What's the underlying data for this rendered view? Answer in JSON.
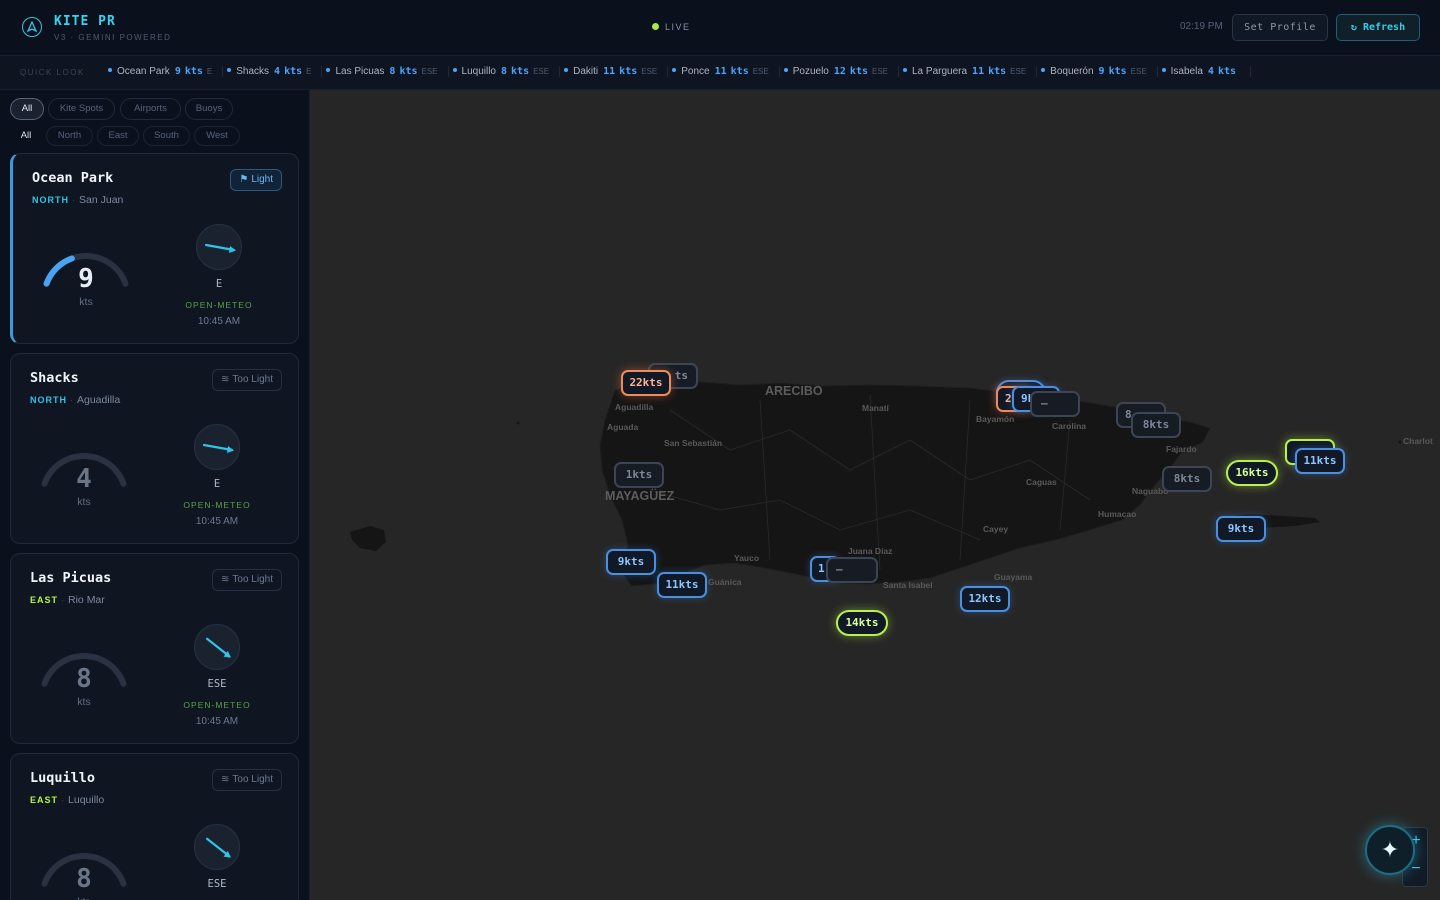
{
  "header": {
    "title": "KITE PR",
    "subtitle": "V3 · GEMINI POWERED",
    "live_label": "LIVE",
    "time": "02:19 PM",
    "set_profile": "Set Profile",
    "refresh": "↻ Refresh",
    "colors": {
      "accent": "#34d3f0",
      "live": "#a8e84a"
    }
  },
  "ticker": {
    "label": "QUICK LOOK",
    "items": [
      {
        "name": "Ocean Park",
        "value": "9",
        "unit": "kts",
        "dir": "E"
      },
      {
        "name": "Shacks",
        "value": "4",
        "unit": "kts",
        "dir": "E"
      },
      {
        "name": "Las Picuas",
        "value": "8",
        "unit": "kts",
        "dir": "ESE"
      },
      {
        "name": "Luquillo",
        "value": "8",
        "unit": "kts",
        "dir": "ESE"
      },
      {
        "name": "Dakiti",
        "value": "11",
        "unit": "kts",
        "dir": "ESE"
      },
      {
        "name": "Ponce",
        "value": "11",
        "unit": "kts",
        "dir": "ESE"
      },
      {
        "name": "Pozuelo",
        "value": "12",
        "unit": "kts",
        "dir": "ESE"
      },
      {
        "name": "La Parguera",
        "value": "11",
        "unit": "kts",
        "dir": "ESE"
      },
      {
        "name": "Boquerón",
        "value": "9",
        "unit": "kts",
        "dir": "ESE"
      },
      {
        "name": "Isabela",
        "value": "4",
        "unit": "kts",
        "dir": ""
      }
    ]
  },
  "filters": {
    "types": [
      "All",
      "Kite Spots",
      "Airports",
      "Buoys"
    ],
    "regions": [
      "All",
      "North",
      "East",
      "South",
      "West"
    ]
  },
  "spots": [
    {
      "name": "Ocean Park",
      "region": "NORTH",
      "location": "San Juan",
      "badge": "Light",
      "badge_icon": "flag-icon",
      "speed": "9",
      "unit": "kts",
      "direction": "E",
      "source": "OPEN-METEO",
      "time": "10:45 AM",
      "gauge_fraction": 0.36,
      "region_color": "#2ec5e6"
    },
    {
      "name": "Shacks",
      "region": "NORTH",
      "location": "Aguadilla",
      "badge": "Too Light",
      "badge_icon": "zzz-icon",
      "speed": "4",
      "unit": "kts",
      "direction": "E",
      "source": "OPEN-METEO",
      "time": "10:45 AM",
      "gauge_fraction": 0.0,
      "region_color": "#2ec5e6"
    },
    {
      "name": "Las Picuas",
      "region": "EAST",
      "location": "Rio Mar",
      "badge": "Too Light",
      "badge_icon": "zzz-icon",
      "speed": "8",
      "unit": "kts",
      "direction": "ESE",
      "source": "OPEN-METEO",
      "time": "10:45 AM",
      "gauge_fraction": 0.0,
      "region_color": "#b8f24a"
    },
    {
      "name": "Luquillo",
      "region": "EAST",
      "location": "Luquillo",
      "badge": "Too Light",
      "badge_icon": "zzz-icon",
      "speed": "8",
      "unit": "kts",
      "direction": "ESE",
      "source": "",
      "time": "",
      "gauge_fraction": 0.0,
      "region_color": "#b8f24a"
    }
  ],
  "map": {
    "cities": [
      "ARECIBO",
      "MAYAGÜEZ",
      "Aguadilla",
      "Aguada",
      "San Sebastián",
      "Manatí",
      "Bayamón",
      "Carolina",
      "Caguas",
      "Fajardo",
      "Naguabo",
      "Humacao",
      "Cayey",
      "Juana Díaz",
      "Santa Isabel",
      "Guayama",
      "Yauco",
      "Guánica",
      "Charlot"
    ],
    "markers": [
      "22kts",
      "ts",
      "1kts",
      "9kts",
      "11kts",
      "1",
      "–",
      "14kts",
      "12kts",
      "2",
      "9k",
      "–",
      "8",
      "8kts",
      "8kts",
      "16kts",
      "11kts",
      "9kts"
    ]
  },
  "fab_icon": "sparkle-icon"
}
